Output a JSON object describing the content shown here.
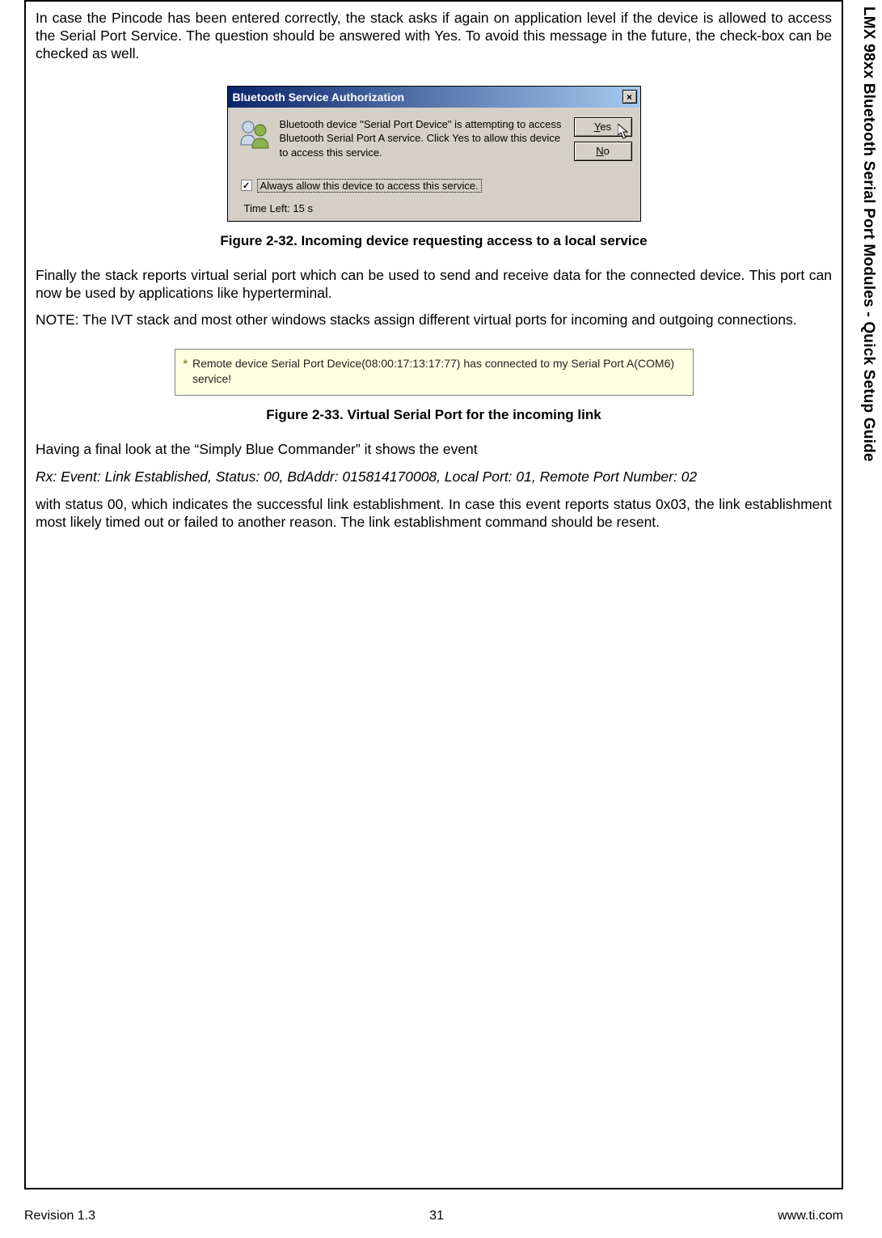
{
  "sidetab": "LMX 98xx Bluetooth Serial Port Modules - Quick Setup Guide",
  "para1": "In case the Pincode has been entered correctly, the stack asks if again on application level if the device is allowed to access the Serial Port Service. The question should be answered with Yes. To avoid this message in the future, the check-box can be checked as well.",
  "dialog1": {
    "title": "Bluetooth Service Authorization",
    "close": "×",
    "message": "Bluetooth device \"Serial Port Device\" is attempting to access Bluetooth Serial Port A service. Click Yes to allow this device to access this service.",
    "yes_first": "Y",
    "yes_rest": "es",
    "no_first": "N",
    "no_rest": "o",
    "checkbox_label": "Always allow this device to access this service.",
    "checkbox_checked": "✓",
    "time_left": "Time Left: 15 s"
  },
  "fig32": "Figure 2-32.  Incoming device requesting access to a local service",
  "para2": "Finally the stack reports virtual serial port which can be used to send and receive data for the connected device. This port can now be used by applications like hyperterminal.",
  "para3": "NOTE: The IVT stack and most other windows stacks assign different virtual ports for incoming and outgoing connections.",
  "notification": {
    "bullet": "*",
    "text": "Remote device Serial Port Device(08:00:17:13:17:77)  has connected to my  Serial Port A(COM6) service!"
  },
  "fig33": "Figure 2-33.  Virtual Serial Port for the incoming link",
  "para4": "Having a final look at the “Simply Blue Commander” it shows the event",
  "para5": "Rx: Event: Link Established, Status: 00, BdAddr: 015814170008, Local Port: 01, Remote Port Number: 02",
  "para6": "with status 00, which indicates the successful link establishment. In case this event reports status 0x03, the link establishment most likely timed out or failed to another reason. The link establishment command should be resent.",
  "footer": {
    "left": "Revision 1.3",
    "center": "31",
    "right": "www.ti.com"
  }
}
